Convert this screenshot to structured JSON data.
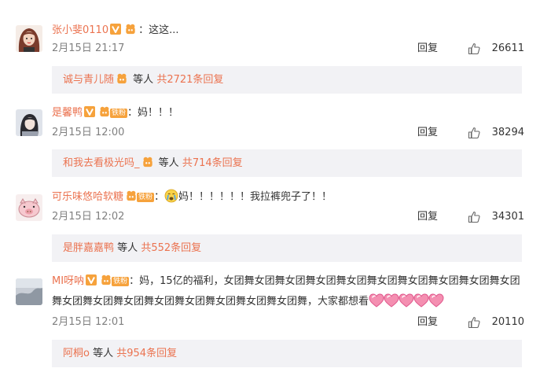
{
  "comments": [
    {
      "username": "张小斐0110",
      "colon": "：",
      "text": "这这...",
      "date": "2月15日 21:17",
      "reply_label": "回复",
      "likes": "26611",
      "replies": {
        "name": "诚与青儿随",
        "wait": "等人",
        "count": "共2721条回复"
      }
    },
    {
      "username": "是馨鸭",
      "fan_label": "铁粉",
      "colon": "：",
      "text": "妈！！！",
      "date": "2月15日 12:00",
      "reply_label": "回复",
      "likes": "38294",
      "replies": {
        "name": "和我去看极光吗_",
        "wait": "等人",
        "count": "共714条回复"
      }
    },
    {
      "username": "可乐味悠哈软糖",
      "fan_label": "铁粉",
      "colon": "：",
      "text": "妈！！！！！！我拉裤兜子了！！",
      "date": "2月15日 12:02",
      "reply_label": "回复",
      "likes": "34301",
      "replies": {
        "name": "是胖嘉嘉鸭",
        "wait": "等人",
        "count": "共552条回复"
      }
    },
    {
      "username": "MI呀呐",
      "fan_label": "铁粉",
      "colon": "：",
      "text": "妈，15亿的福利，女团舞女团舞女团舞女团舞女团舞女团舞女团舞女团舞女团舞女团舞女团舞女团舞女团舞女团舞女团舞女团舞女团舞女团舞，大家都想看",
      "date": "2月15日 12:01",
      "reply_label": "回复",
      "likes": "20110",
      "replies": {
        "name": "阿桐o",
        "wait": "等人",
        "count": "共954条回复"
      }
    }
  ],
  "colors": {
    "username": "#eb7350",
    "reply_bg": "#f2f2f5",
    "vip_gold": "#f6a23c"
  },
  "icons": [
    "vip-v-icon",
    "fan-badge-icon",
    "thumbs-up-icon",
    "heart-emoji-icon",
    "crying-emoji-icon"
  ]
}
